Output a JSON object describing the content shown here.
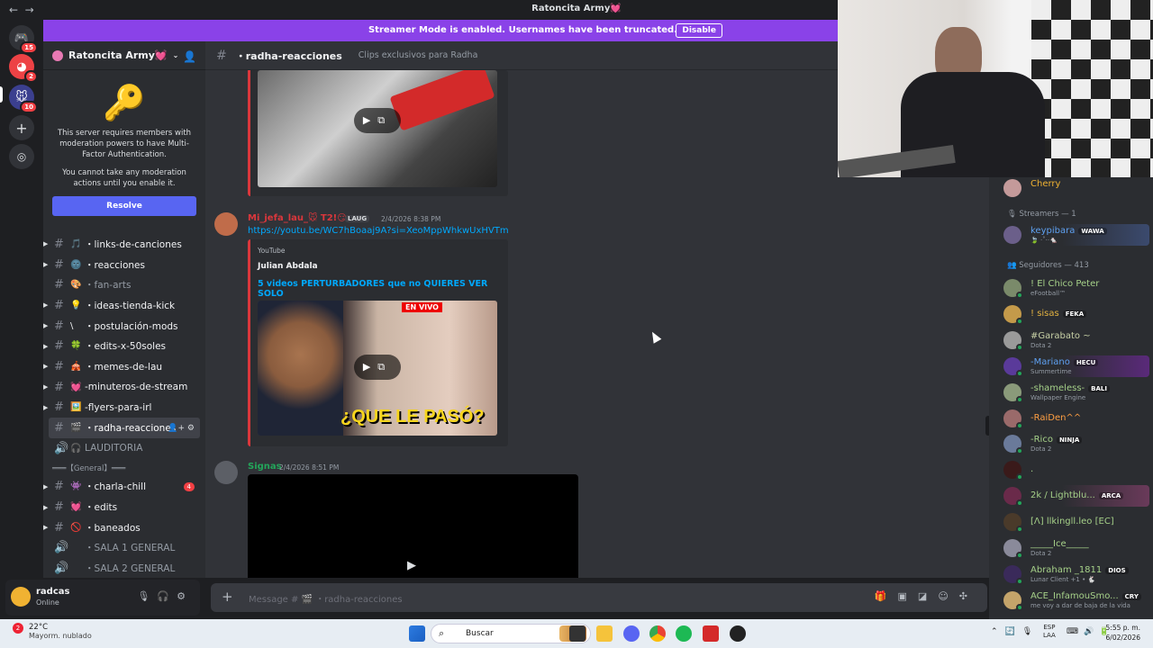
{
  "window": {
    "title": "Ratoncita Army💓"
  },
  "banner": {
    "text": "Streamer Mode is enabled. Usernames have been truncated.",
    "button": "Disable"
  },
  "servers": [
    {
      "badge": "15"
    },
    {
      "badge": "2"
    },
    {
      "badge": "10"
    }
  ],
  "server": {
    "name": "Ratoncita Army💓",
    "mfa_text1": "This server requires members with moderation powers to have Multi-Factor Authentication.",
    "mfa_text2": "You cannot take any moderation actions until you enable it.",
    "resolve": "Resolve"
  },
  "channels": [
    {
      "emoji": "🎵",
      "label": "・links-de-canciones",
      "unread": true,
      "arrow": true
    },
    {
      "emoji": "🌚",
      "label": "・reacciones",
      "unread": true,
      "arrow": true
    },
    {
      "emoji": "🎨",
      "label": "・fan-arts",
      "unread": false,
      "arrow": false
    },
    {
      "emoji": "💡",
      "label": "・ideas-tienda-kick",
      "unread": true,
      "arrow": true
    },
    {
      "emoji": "\\",
      "label": "・postulación-mods",
      "unread": true,
      "arrow": true
    },
    {
      "emoji": "🍀",
      "label": "・edits-x-50soles",
      "unread": true,
      "arrow": true
    },
    {
      "emoji": "🎪",
      "label": "・memes-de-lau",
      "unread": true,
      "arrow": true
    },
    {
      "emoji": "💓",
      "label": "-minuteros-de-stream",
      "unread": true,
      "arrow": true
    },
    {
      "emoji": "🖼️",
      "label": "-flyers-para-irl",
      "unread": true,
      "arrow": true
    },
    {
      "emoji": "🎬",
      "label": "・radha-reacciones",
      "unread": true,
      "arrow": false,
      "active": true
    },
    {
      "emoji": "🎧",
      "label": "LAUDITORIA",
      "unread": false,
      "arrow": false,
      "voice": true
    }
  ],
  "category": "═══【General】═══",
  "channels2": [
    {
      "emoji": "👾",
      "label": "・charla-chill",
      "unread": true,
      "mention": "4"
    },
    {
      "emoji": "💓",
      "label": "・edits",
      "unread": true
    },
    {
      "emoji": "🚫",
      "label": "・baneados",
      "unread": true
    },
    {
      "emoji": "",
      "label": "・SALA 1 GENERAL",
      "unread": false,
      "voice": true
    },
    {
      "emoji": "",
      "label": "・SALA 2 GENERAL",
      "unread": false,
      "voice": true
    }
  ],
  "user": {
    "name": "radcas",
    "status": "Online"
  },
  "chat": {
    "channel": "・radha-reacciones",
    "topic": "Clips exclusivos para Radha",
    "msg1": {
      "author": "Mi_jefa_lau_🐭 T2!😏",
      "tag": "LAUG",
      "time": "2/4/2026 8:38 PM",
      "link": "https://youtu.be/WC7hBoaaj9A?si=XeoMppWhkwUxHVTm",
      "provider": "YouTube",
      "embed_author": "Julian Abdala",
      "embed_title": "5 videos PERTURBADORES que no QUIERES VER SOLO",
      "thumb_caption": "¿QUE LE PASÓ?",
      "live": "EN VIVO"
    },
    "msg2": {
      "author": "Signas",
      "time": "2/4/2026 8:51 PM"
    },
    "placeholder": "Message # 🎬 ・radha-reacciones"
  },
  "members": {
    "top": {
      "name": "Cherry"
    },
    "streamers_header": "🎙 Streamers — 1",
    "streamers": [
      {
        "name": "keypibara",
        "tag": "WAWA",
        "sub": "🍃 ·˚‧·🐁"
      }
    ],
    "followers_header": "👥 Seguidores — 413",
    "followers": [
      {
        "name": "! El Chico Peter",
        "sub": "eFootball™",
        "color": "#a6d189"
      },
      {
        "name": "! sisas",
        "tag": "FEKA",
        "sub": "",
        "color": "#e3b341"
      },
      {
        "name": "#Garabato ~",
        "sub": "Dota 2",
        "color": "#c7d0a6"
      },
      {
        "name": "-Mariano",
        "tag": "HECU",
        "sub": "Summertime",
        "color": "#5ea0f0"
      },
      {
        "name": "-shameless-",
        "tag": "BALI",
        "sub": "Wallpaper Engine",
        "color": "#a6d189"
      },
      {
        "name": "-RaiDen^^",
        "sub": "",
        "color": "#ff9f43"
      },
      {
        "name": "-Rico",
        "tag": "NINJA",
        "sub": "Dota 2",
        "color": "#a6d189"
      },
      {
        "name": ".",
        "sub": "",
        "color": "#a6d189"
      },
      {
        "name": "2k / Lightblu...",
        "tag": "ARCA",
        "sub": "",
        "color": "#a6d189"
      },
      {
        "name": "[Λ] llkingll.leo [EC]",
        "sub": "",
        "color": "#a6d189"
      },
      {
        "name": "_____Ice_____",
        "sub": "Dota 2",
        "color": "#a6d189"
      },
      {
        "name": "Abraham _1811",
        "tag": "DIOS",
        "sub": "Lunar Client +1 • 🐇",
        "color": "#a6d189"
      },
      {
        "name": "ACE_InfamouSmo...",
        "tag": "CRY",
        "sub": "me voy a dar de baja de la vida",
        "color": "#a6d189"
      }
    ]
  },
  "taskbar": {
    "badge": "2",
    "temp": "22°C",
    "weather": "Mayorm. nublado",
    "search": "Buscar",
    "lang1": "ESP",
    "lang2": "LAA",
    "time": "5:55 p. m.",
    "date": "6/02/2026"
  }
}
